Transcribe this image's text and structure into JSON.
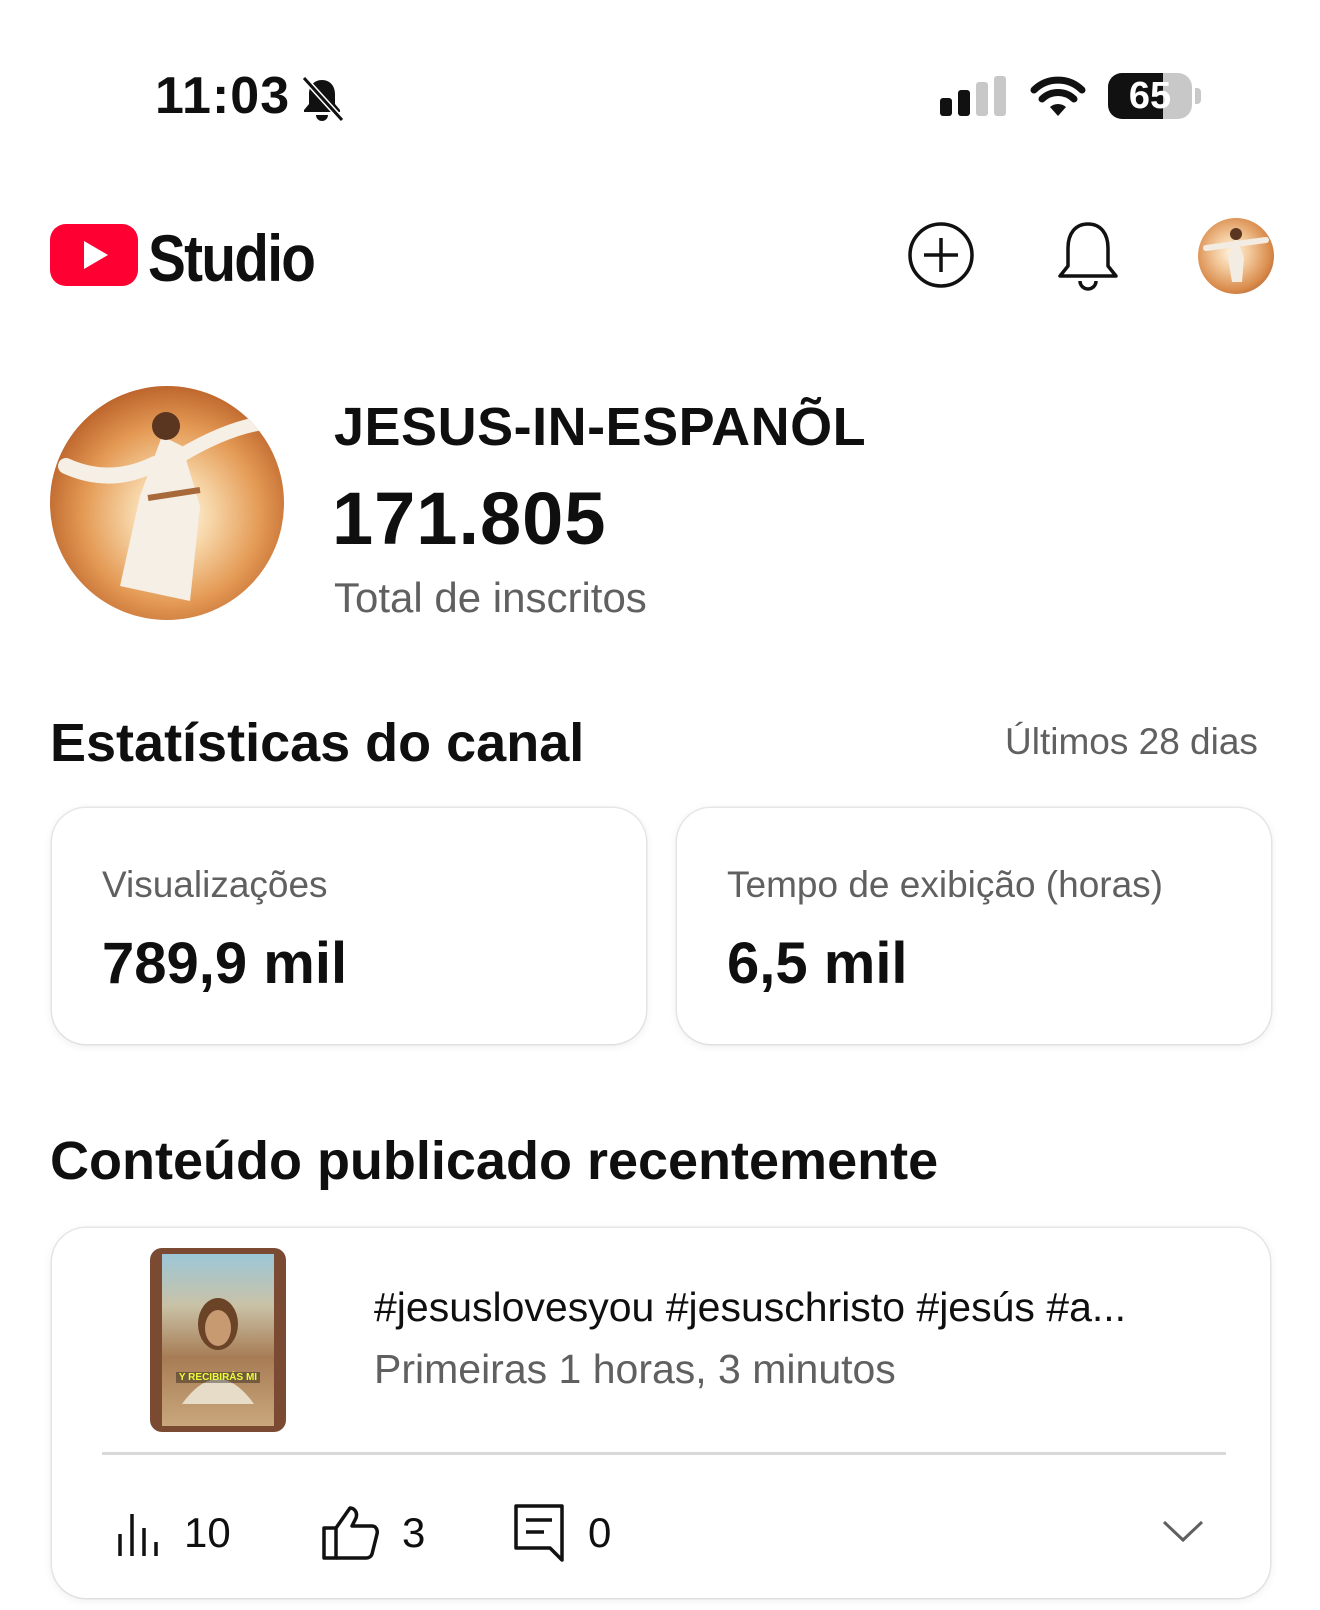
{
  "status_bar": {
    "time": "11:03",
    "battery": "65",
    "battery_level": 0.65,
    "icons": [
      "bell-off-icon",
      "signal-icon",
      "wifi-icon",
      "battery-icon"
    ]
  },
  "header": {
    "app_name": "Studio",
    "icons": [
      "youtube-logo-icon",
      "create-plus-icon",
      "notification-bell-icon",
      "account-avatar"
    ]
  },
  "channel": {
    "name": "JESUS-IN-ESPANÕL",
    "subscribers": "171.805",
    "subscribers_label": "Total de inscritos"
  },
  "stats": {
    "title": "Estatísticas do canal",
    "period": "Últimos 28 dias",
    "cards": [
      {
        "label": "Visualizações",
        "value": "789,9 mil"
      },
      {
        "label": "Tempo de exibição (horas)",
        "value": "6,5 mil"
      }
    ]
  },
  "recent": {
    "title": "Conteúdo publicado recentemente",
    "video": {
      "title": "#jesuslovesyou #jesuschristo #jesús #a...",
      "subtitle": "Primeiras 1 horas, 3 minutos",
      "thumbnail_text": "Y RECIBIRÁS MI",
      "views": "10",
      "likes": "3",
      "comments": "0"
    }
  },
  "colors": {
    "youtube_red": "#FF0033",
    "text_primary": "#0F0F0F",
    "text_secondary": "#606060"
  }
}
